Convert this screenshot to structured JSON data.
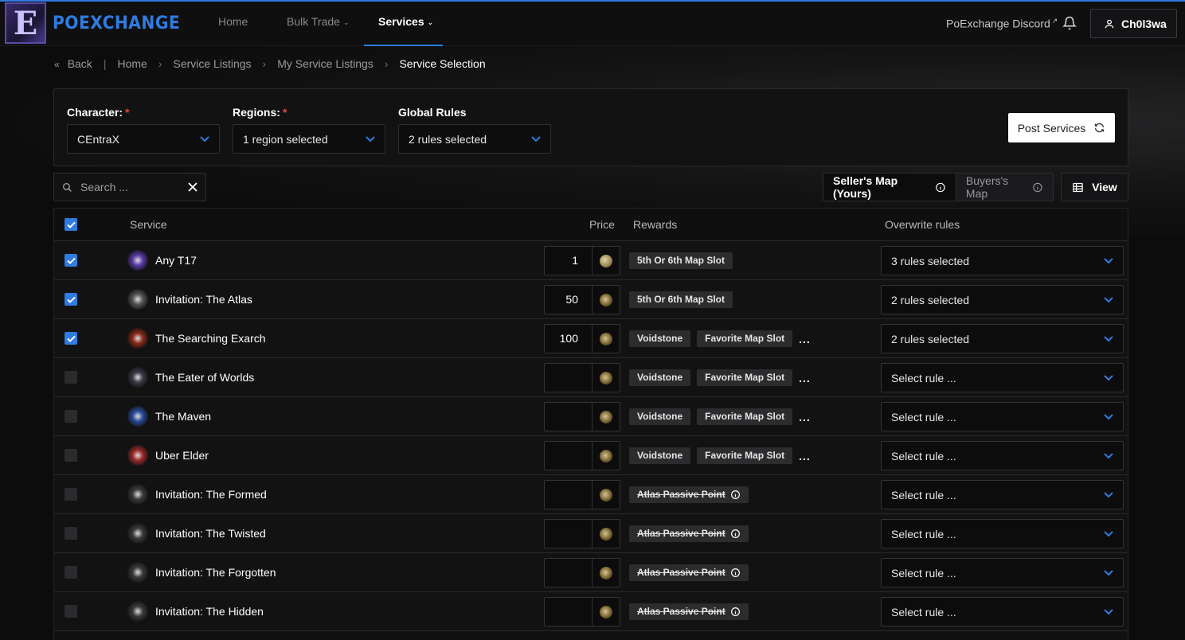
{
  "header": {
    "logo_letter": "E",
    "brand": "POEXCHANGE",
    "nav": [
      {
        "label": "Home"
      },
      {
        "label": "Bulk Trade"
      },
      {
        "label": "Services"
      }
    ],
    "discord_label": "PoExchange Discord",
    "username": "Ch0l3wa"
  },
  "breadcrumb": {
    "back": "Back",
    "items": [
      "Home",
      "Service Listings",
      "My Service Listings",
      "Service Selection"
    ]
  },
  "filters": {
    "character_label": "Character:",
    "character_value": "CEntraX",
    "regions_label": "Regions:",
    "regions_value": "1 region selected",
    "rules_label": "Global Rules",
    "rules_value": "2 rules selected",
    "required_mark": "*",
    "post_button": "Post Services"
  },
  "toolbar": {
    "search_placeholder": "Search ...",
    "seller_map": "Seller's Map (Yours)",
    "buyer_map": "Buyers's Map",
    "view_label": "View"
  },
  "table": {
    "headers": {
      "service": "Service",
      "price": "Price",
      "rewards": "Rewards",
      "rules": "Overwrite rules"
    },
    "rows": [
      {
        "name": "Any T17",
        "checked": true,
        "price": "1",
        "currency": "divine",
        "icon_color": "#5a3aa8",
        "rewards": [
          "5th Or 6th Map Slot"
        ],
        "more": false,
        "strike": false,
        "rule": "3 rules selected"
      },
      {
        "name": "Invitation: The Atlas",
        "checked": true,
        "price": "50",
        "currency": "chaos",
        "icon_color": "#555",
        "rewards": [
          "5th Or 6th Map Slot"
        ],
        "more": false,
        "strike": false,
        "rule": "2 rules selected"
      },
      {
        "name": "The Searching Exarch",
        "checked": true,
        "price": "100",
        "currency": "chaos",
        "icon_color": "#8a2a1a",
        "rewards": [
          "Voidstone",
          "Favorite Map Slot"
        ],
        "more": true,
        "strike": false,
        "rule": "2 rules selected"
      },
      {
        "name": "The Eater of Worlds",
        "checked": false,
        "price": "",
        "currency": "chaos",
        "icon_color": "#3a3a48",
        "rewards": [
          "Voidstone",
          "Favorite Map Slot"
        ],
        "more": true,
        "strike": false,
        "rule": "Select rule ..."
      },
      {
        "name": "The Maven",
        "checked": false,
        "price": "",
        "currency": "chaos",
        "icon_color": "#2a4a9a",
        "rewards": [
          "Voidstone",
          "Favorite Map Slot"
        ],
        "more": true,
        "strike": false,
        "rule": "Select rule ..."
      },
      {
        "name": "Uber Elder",
        "checked": false,
        "price": "",
        "currency": "chaos",
        "icon_color": "#9a2a2a",
        "rewards": [
          "Voidstone",
          "Favorite Map Slot"
        ],
        "more": true,
        "strike": false,
        "rule": "Select rule ..."
      },
      {
        "name": "Invitation: The Formed",
        "checked": false,
        "price": "",
        "currency": "chaos",
        "icon_color": "#3a3a3a",
        "rewards": [
          "Atlas Passive Point"
        ],
        "more": false,
        "strike": true,
        "rule": "Select rule ..."
      },
      {
        "name": "Invitation: The Twisted",
        "checked": false,
        "price": "",
        "currency": "chaos",
        "icon_color": "#3a3a3a",
        "rewards": [
          "Atlas Passive Point"
        ],
        "more": false,
        "strike": true,
        "rule": "Select rule ..."
      },
      {
        "name": "Invitation: The Forgotten",
        "checked": false,
        "price": "",
        "currency": "chaos",
        "icon_color": "#3a3a3a",
        "rewards": [
          "Atlas Passive Point"
        ],
        "more": false,
        "strike": true,
        "rule": "Select rule ..."
      },
      {
        "name": "Invitation: The Hidden",
        "checked": false,
        "price": "",
        "currency": "chaos",
        "icon_color": "#3a3a3a",
        "rewards": [
          "Atlas Passive Point"
        ],
        "more": false,
        "strike": true,
        "rule": "Select rule ..."
      }
    ]
  },
  "colors": {
    "accent": "#2f7be0",
    "required": "#e0453a"
  }
}
